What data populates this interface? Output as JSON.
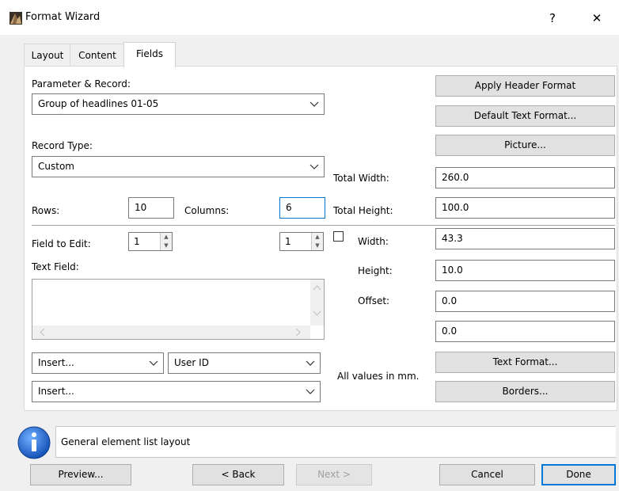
{
  "window": {
    "title": "Format Wizard",
    "help_glyph": "?",
    "close_glyph": "✕"
  },
  "tabs": [
    {
      "label": "Layout"
    },
    {
      "label": "Content"
    },
    {
      "label": "Fields",
      "active": true
    }
  ],
  "form": {
    "param_label": "Parameter & Record:",
    "param_value": "Group of headlines 01-05",
    "record_type_label": "Record Type:",
    "record_type_value": "Custom",
    "rows_label": "Rows:",
    "rows_value": "10",
    "columns_label": "Columns:",
    "columns_value": "6",
    "field_to_edit_label": "Field to Edit:",
    "field_to_edit_value": "1",
    "field_col_value": "1",
    "text_field_label": "Text Field:",
    "text_field_value": "",
    "insert1_value": "Insert...",
    "userid_value": "User ID",
    "insert2_value": "Insert..."
  },
  "right": {
    "apply_header_btn": "Apply Header Format",
    "default_text_btn": "Default Text Format...",
    "picture_btn": "Picture...",
    "total_width_label": "Total Width:",
    "total_width_value": "260.0",
    "total_height_label": "Total Height:",
    "total_height_value": "100.0",
    "width_label": "Width:",
    "width_checked": false,
    "width_value": "43.3",
    "height_label": "Height:",
    "height_value": "10.0",
    "offset_label": "Offset:",
    "offset_value1": "0.0",
    "offset_value2": "0.0",
    "units_note": "All values in mm.",
    "text_format_btn": "Text Format...",
    "borders_btn": "Borders..."
  },
  "status": {
    "message": "General element list layout"
  },
  "footer": {
    "preview_btn": "Preview...",
    "back_btn": "< Back",
    "next_btn": "Next >",
    "cancel_btn": "Cancel",
    "done_btn": "Done"
  },
  "colors": {
    "accent": "#0078d7",
    "frame": "#f0f0f0",
    "button": "#e1e1e1",
    "info_icon": "#1e6fd1"
  },
  "icons": {
    "app": "format-wizard-app-icon",
    "info": "info-icon",
    "dropdown": "chevron-down-icon"
  }
}
